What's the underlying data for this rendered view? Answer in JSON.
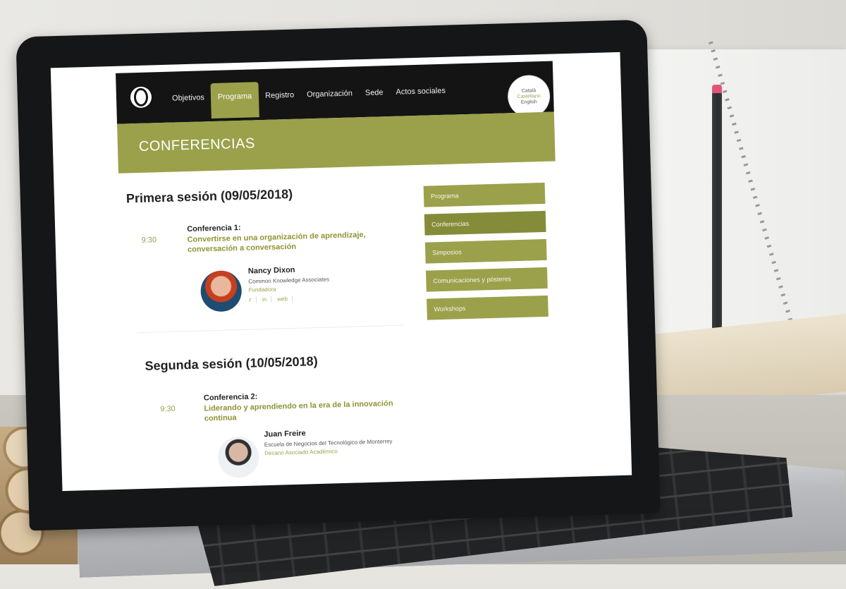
{
  "site": {
    "nav": [
      "Objetivos",
      "Programa",
      "Registro",
      "Organización",
      "Sede",
      "Actos sociales"
    ],
    "active_nav": "Programa",
    "languages": [
      "Català",
      "Castellano",
      "English"
    ],
    "selected_language": "Castellano",
    "banner_title": "CONFERENCIAS"
  },
  "sessions": [
    {
      "title": "Primera sesión (09/05/2018)",
      "time": "9:30",
      "conf_label": "Conferencia 1:",
      "conf_title": "Convertirse en una organización de aprendizaje, conversación a conversación",
      "speaker": {
        "name": "Nancy Dixon",
        "org": "Common Knowledge Associates",
        "role": "Fundadora",
        "socials": [
          "twitter-icon",
          "linkedin-icon",
          "web"
        ],
        "web_label": "web"
      }
    },
    {
      "title": "Segunda sesión (10/05/2018)",
      "time": "9:30",
      "conf_label": "Conferencia 2:",
      "conf_title": "Liderando y aprendiendo en la era de la innovación continua",
      "speaker": {
        "name": "Juan Freire",
        "org": "Escuela de Negocios del Tecnológico de Monterrey",
        "role": "Decano Asociado Académico"
      }
    }
  ],
  "sidebar": {
    "items": [
      "Programa",
      "Conferencias",
      "Simposios",
      "Comunicaciones y pósteres",
      "Workshops"
    ],
    "active": "Conferencias"
  },
  "colors": {
    "accent": "#9aa14a",
    "accent_dark": "#858c39",
    "topbar": "#141414"
  }
}
